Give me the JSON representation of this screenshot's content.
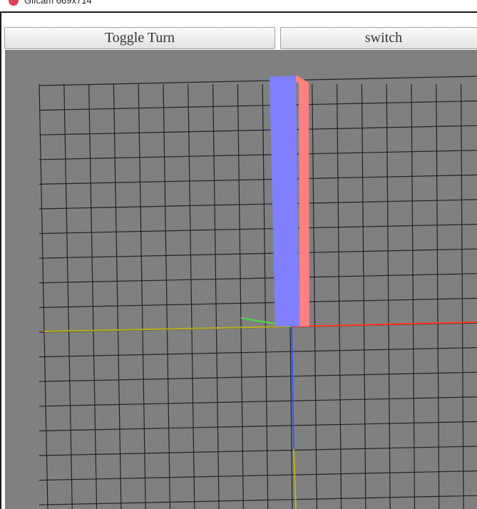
{
  "window": {
    "title": "Gifcam 669x714"
  },
  "toolbar": {
    "toggle_turn_label": "Toggle Turn",
    "switch_label": "switch"
  },
  "scene": {
    "background_color": "#808080",
    "grid_color": "#222222",
    "cube_front_color": "#8080ff",
    "cube_side_color": "#ff8080",
    "axis_x_color": "#ff3b1f",
    "axis_y_color": "#3355ff",
    "axis_z_color": "#44dd44",
    "axis_neg_color": "#b8b020"
  }
}
